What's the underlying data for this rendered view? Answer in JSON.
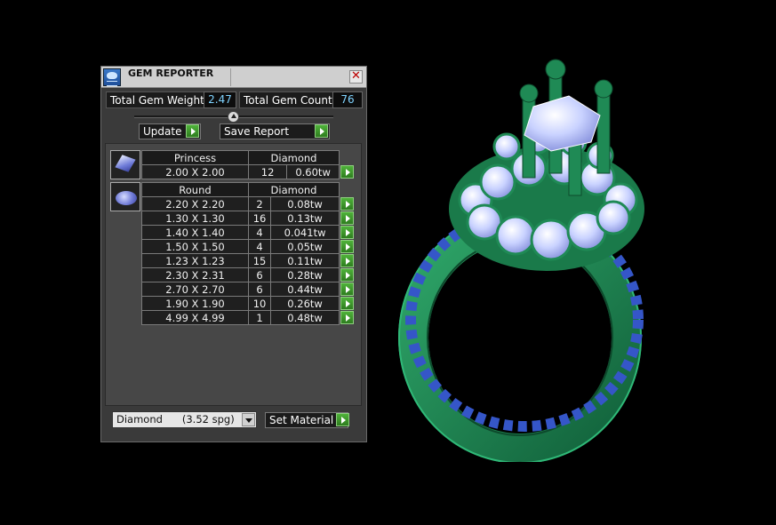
{
  "window": {
    "title": "GEM REPORTER"
  },
  "stats": {
    "weight_label": "Total Gem Weight",
    "weight_value": "2.47",
    "count_label": "Total Gem Count",
    "count_value": "76"
  },
  "buttons": {
    "update": "Update",
    "save_report": "Save Report",
    "set_material": "Set Material"
  },
  "groups": [
    {
      "shape": "Princess",
      "material": "Diamond",
      "rows": [
        {
          "size": "2.00 X 2.00",
          "count": "12",
          "weight": "0.60tw"
        }
      ]
    },
    {
      "shape": "Round",
      "material": "Diamond",
      "rows": [
        {
          "size": "2.20 X 2.20",
          "count": "2",
          "weight": "0.08tw"
        },
        {
          "size": "1.30 X 1.30",
          "count": "16",
          "weight": "0.13tw"
        },
        {
          "size": "1.40 X 1.40",
          "count": "4",
          "weight": "0.041tw"
        },
        {
          "size": "1.50 X 1.50",
          "count": "4",
          "weight": "0.05tw"
        },
        {
          "size": "1.23 X 1.23",
          "count": "15",
          "weight": "0.11tw"
        },
        {
          "size": "2.30 X 2.31",
          "count": "6",
          "weight": "0.28tw"
        },
        {
          "size": "2.70 X 2.70",
          "count": "6",
          "weight": "0.44tw"
        },
        {
          "size": "1.90 X 1.90",
          "count": "10",
          "weight": "0.26tw"
        },
        {
          "size": "4.99 X 4.99",
          "count": "1",
          "weight": "0.48tw"
        }
      ]
    }
  ],
  "material_select": {
    "value": "Diamond      (3.52 spg)"
  },
  "colors": {
    "metal": "#1f8a55",
    "gem": "#cfd8ff",
    "value_text": "#7fd3ff",
    "go_button": "#3a9a2a"
  }
}
